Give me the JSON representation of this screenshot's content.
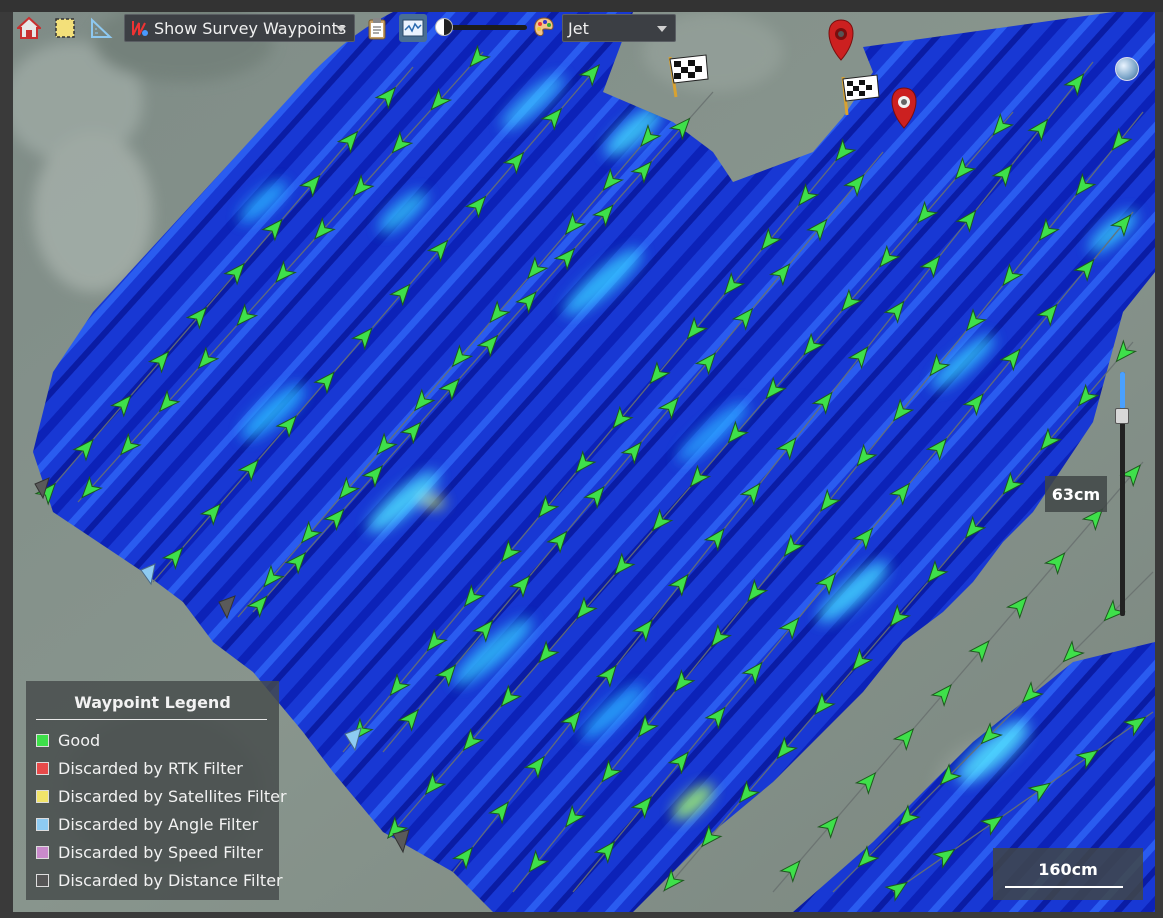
{
  "toolbar": {
    "survey_dropdown": {
      "selected": "Show Survey Waypoints"
    },
    "colormap_dropdown": {
      "selected": "Jet"
    },
    "icons": [
      "home-icon",
      "select-region-icon",
      "measure-icon",
      "waypoints-icon",
      "clipboard-icon",
      "chart-icon",
      "contrast-icon",
      "palette-icon"
    ]
  },
  "legend": {
    "title": "Waypoint Legend",
    "items": [
      {
        "label": "Good",
        "color": "#3ee04a"
      },
      {
        "label": "Discarded by RTK Filter",
        "color": "#e84a4a"
      },
      {
        "label": "Discarded by Satellites Filter",
        "color": "#f1e46a"
      },
      {
        "label": "Discarded by Angle Filter",
        "color": "#8ecbf2"
      },
      {
        "label": "Discarded by Speed Filter",
        "color": "#c98acb"
      },
      {
        "label": "Discarded by Distance Filter",
        "color": "#555555"
      }
    ]
  },
  "zoom": {
    "label": "63cm",
    "level": 0.15
  },
  "scale": {
    "label": "160cm"
  },
  "colors": {
    "survey_fill": "#1a4ad8",
    "waypoint_good": "#3ee04a",
    "background": "#2b2b2b"
  }
}
